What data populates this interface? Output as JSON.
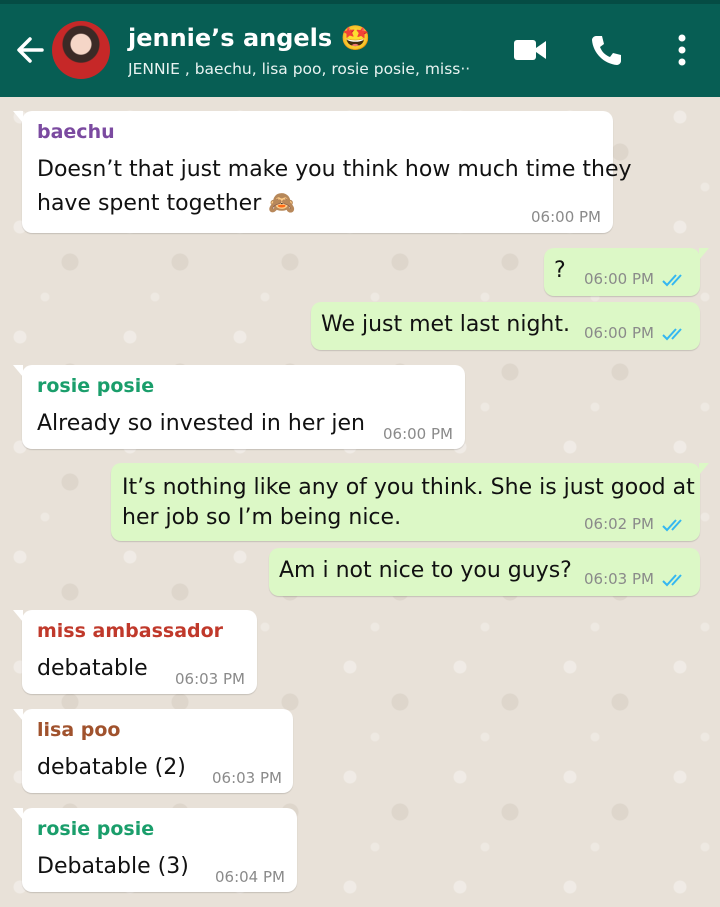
{
  "header": {
    "title": "jennie’s angels 🤩",
    "subtitle": "JENNIE , baechu, lisa poo, rosie posie, miss‧‧",
    "icons": [
      "back-arrow-icon",
      "video-call-icon",
      "phone-icon",
      "more-options-icon"
    ]
  },
  "colors": {
    "header_bg": "#075e54",
    "incoming_bubble": "#ffffff",
    "outgoing_bubble": "#dcf8c6",
    "read_ticks": "#34b7f1",
    "sender_baechu": "#7b4aa0",
    "sender_rosie": "#1a9e6b",
    "sender_miss": "#c0392b",
    "sender_lisa": "#a0522d"
  },
  "messages": [
    {
      "sender": "baechu",
      "text1": "Doesn’t that just make you think how much time they",
      "text2": "have spent together 🙈",
      "time": "06:00 PM"
    },
    {
      "text": "?",
      "time": "06:00 PM"
    },
    {
      "text": "We just met last night.",
      "time": "06:00 PM"
    },
    {
      "sender": "rosie posie",
      "text": "Already so invested in her jen",
      "time": "06:00 PM"
    },
    {
      "text1": "It’s nothing like any of you think. She is just good at",
      "text2": "her job so I’m being nice.",
      "time": "06:02 PM"
    },
    {
      "text": "Am i not nice to you guys?",
      "time": "06:03 PM"
    },
    {
      "sender": "miss ambassador",
      "text": "debatable",
      "time": "06:03 PM"
    },
    {
      "sender": "lisa poo",
      "text": "debatable (2)",
      "time": "06:03 PM"
    },
    {
      "sender": "rosie posie",
      "text": "Debatable (3)",
      "time": "06:04 PM"
    }
  ]
}
